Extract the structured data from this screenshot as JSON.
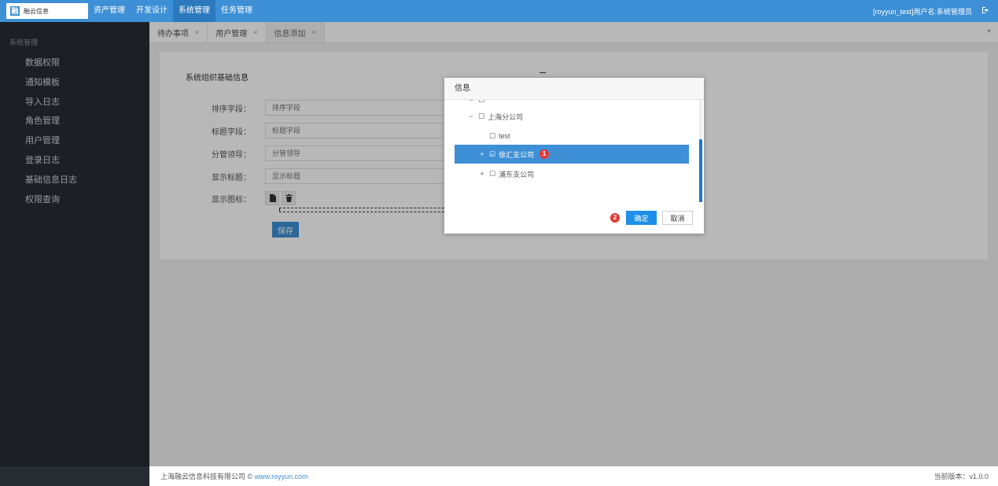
{
  "header": {
    "logo_mark": "融",
    "logo_text": "融云信息",
    "nav": [
      "资产管理",
      "开发设计",
      "系统管理",
      "任务管理"
    ],
    "active_nav_index": 2,
    "user_info": "[royyun_test]用户名:系统管理员",
    "logout_icon": "logout-icon"
  },
  "sidebar": {
    "title": "系统管理",
    "items": [
      "数据权限",
      "通知模板",
      "导入日志",
      "角色管理",
      "用户管理",
      "登录日志",
      "基础信息日志",
      "权限查询"
    ]
  },
  "tabs": [
    {
      "label": "待办事项",
      "close": "×"
    },
    {
      "label": "用户管理",
      "close": "×"
    },
    {
      "label": "信息添加",
      "close": "×"
    }
  ],
  "tab_caret": "▼",
  "form": {
    "section_title": "系统组织基础信息",
    "fields": [
      {
        "label": "排序字段：",
        "placeholder": "排序字段"
      },
      {
        "label": "标题字段：",
        "placeholder": "标题字段"
      },
      {
        "label": "分管领导：",
        "placeholder": "分管领导"
      },
      {
        "label": "显示标题：",
        "placeholder": "显示标题"
      }
    ],
    "icon_label": "显示图标：",
    "save_label": "保存"
  },
  "footer": {
    "company": "上海融云信息科技有限公司 © ",
    "link": "www.royyun.com",
    "version": "当前版本：v1.0.0"
  },
  "modal": {
    "title": "信息",
    "tree": [
      {
        "toggle": "−",
        "check": "☐",
        "label": "上海分公司",
        "level": 1,
        "selected": false
      },
      {
        "toggle": "",
        "check": "☐",
        "label": "test",
        "level": 2,
        "selected": false
      },
      {
        "toggle": "+",
        "check": "☑",
        "label": "徐汇支公司",
        "level": 2,
        "selected": true,
        "badge": "1"
      },
      {
        "toggle": "+",
        "check": "☐",
        "label": "浦东支公司",
        "level": 2,
        "selected": false
      }
    ],
    "confirm_badge": "2",
    "confirm_label": "确定",
    "cancel_label": "取消"
  },
  "colors": {
    "primary": "#3d8fd6",
    "sidebar_bg": "#272c33",
    "badge_red": "#e53935"
  }
}
